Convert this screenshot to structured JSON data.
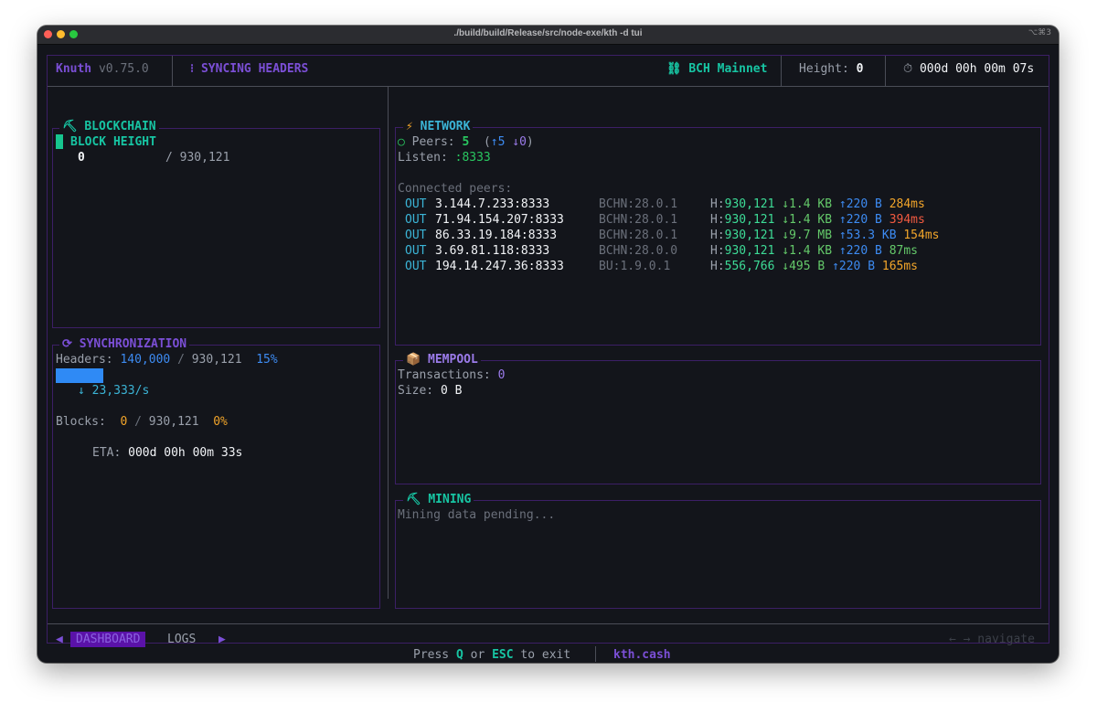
{
  "window": {
    "title": "./build/build/Release/src/node-exe/kth -d tui",
    "shortcut": "⌥⌘3"
  },
  "header": {
    "app_name": "Knuth",
    "version": "v0.75.0",
    "status_icon": "⁝",
    "status": "SYNCING HEADERS",
    "network_icon": "⛓",
    "network": "BCH Mainnet",
    "height_label": "Height:",
    "height_value": "0",
    "uptime_icon": "⏱",
    "uptime": "000d 00h 00m 07s"
  },
  "blockchain": {
    "icon": "⛏",
    "title": "BLOCKCHAIN",
    "block_height_label": "BLOCK HEIGHT",
    "current": "0",
    "separator": "/",
    "total": "930,121"
  },
  "sync": {
    "icon": "⟳",
    "title": "SYNCHRONIZATION",
    "headers_label": "Headers:",
    "headers_current": "140,000",
    "separator": "/",
    "headers_total": "930,121",
    "headers_percent": "15%",
    "headers_progress": 0.15,
    "rate_arrow": "↓",
    "rate": "23,333/s",
    "blocks_label": "Blocks:",
    "blocks_current": "0",
    "blocks_total": "930,121",
    "blocks_percent": "0%",
    "eta_label": "ETA:",
    "eta_value": "000d 00h 00m 33s"
  },
  "network": {
    "icon": "⚡",
    "title": "NETWORK",
    "peers_icon": "○",
    "peers_label": "Peers:",
    "peers_count": "5",
    "peers_paren_open": "(",
    "peers_up": "↑5",
    "peers_down": "↓0",
    "peers_paren_close": ")",
    "listen_label": "Listen:",
    "listen_value": ":8333",
    "connected_label": "Connected peers:",
    "peers": [
      {
        "dir": "OUT",
        "addr": "3.144.7.233:8333",
        "agent": "BCHN:28.0.1",
        "height_label": "H:",
        "height": "930,121",
        "down": "↓1.4 KB",
        "up": "↑220 B",
        "latency": "284ms",
        "latency_color": "#f2a52a"
      },
      {
        "dir": "OUT",
        "addr": "71.94.154.207:8333",
        "agent": "BCHN:28.0.1",
        "height_label": "H:",
        "height": "930,121",
        "down": "↓1.4 KB",
        "up": "↑220 B",
        "latency": "394ms",
        "latency_color": "#f25a40"
      },
      {
        "dir": "OUT",
        "addr": "86.33.19.184:8333",
        "agent": "BCHN:28.0.1",
        "height_label": "H:",
        "height": "930,121",
        "down": "↓9.7 MB",
        "up": "↑53.3 KB",
        "latency": "154ms",
        "latency_color": "#f2a52a"
      },
      {
        "dir": "OUT",
        "addr": "3.69.81.118:8333",
        "agent": "BCHN:28.0.0",
        "height_label": "H:",
        "height": "930,121",
        "down": "↓1.4 KB",
        "up": "↑220 B",
        "latency": "87ms",
        "latency_color": "#64c96a"
      },
      {
        "dir": "OUT",
        "addr": "194.14.247.36:8333",
        "agent": "BU:1.9.0.1",
        "height_label": "H:",
        "height": "556,766",
        "down": "↓495 B",
        "up": "↑220 B",
        "latency": "165ms",
        "latency_color": "#f2a52a"
      }
    ]
  },
  "mempool": {
    "icon": "📦",
    "title": "MEMPOOL",
    "tx_label": "Transactions:",
    "tx_value": "0",
    "size_label": "Size:",
    "size_value": "0 B"
  },
  "mining": {
    "icon": "⛏",
    "title": "MINING",
    "status": "Mining data pending..."
  },
  "footer": {
    "left_arrow": "◀",
    "tabs": [
      "DASHBOARD",
      "LOGS"
    ],
    "active_tab": "DASHBOARD",
    "right_arrow": "▶",
    "nav_hint": "← → navigate",
    "exit_press": "Press",
    "exit_q": "Q",
    "exit_or": "or",
    "exit_esc": "ESC",
    "exit_tail": "to exit",
    "link": "kth.cash"
  },
  "colors": {
    "background": "#13151b",
    "border": "#3c1f66",
    "purple": "#7b4fd6",
    "teal": "#17c5a3",
    "blue": "#3d8bf2",
    "progress": "#2f8af5",
    "green": "#29c760",
    "orange": "#f2a52a",
    "red": "#f25a40"
  }
}
